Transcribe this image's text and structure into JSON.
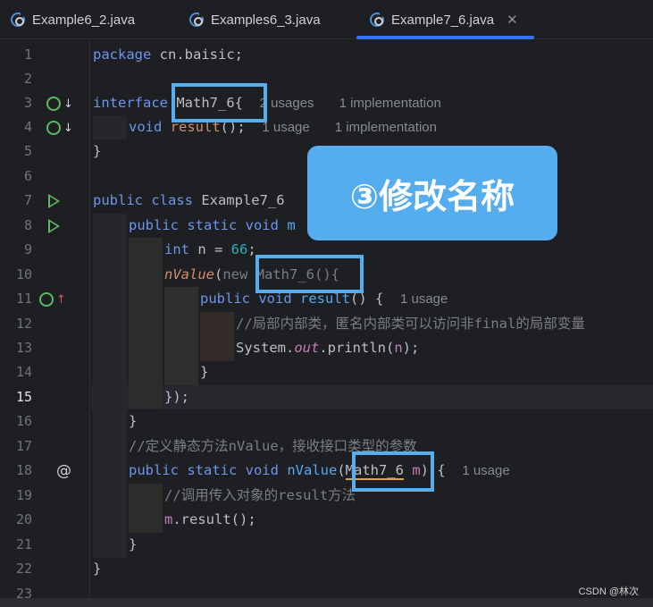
{
  "tabs": [
    {
      "label": "Example6_2.java",
      "active": false
    },
    {
      "label": "Examples6_3.java",
      "active": false
    },
    {
      "label": "Example7_6.java",
      "active": true
    }
  ],
  "line_numbers": [
    "1",
    "2",
    "3",
    "4",
    "5",
    "6",
    "7",
    "8",
    "9",
    "10",
    "11",
    "12",
    "13",
    "14",
    "15",
    "16",
    "17",
    "18",
    "19",
    "20",
    "21",
    "22",
    "23"
  ],
  "code": {
    "l1_kw": "package",
    "l1_rest": " cn.baisic;",
    "l3_kw": "interface",
    "l3_name": "Math7_6{",
    "l3_hint1": "2 usages",
    "l3_hint2": "1 implementation",
    "l4_kw": "void",
    "l4_fn": "result",
    "l4_rest": "();",
    "l4_hint1": "1 usage",
    "l4_hint2": "1 implementation",
    "l5": "}",
    "l7_kw": "public class",
    "l7_name": " Example7_6",
    "l8_kw": "public static void",
    "l8_fn": " m",
    "l9_kw": "int",
    "l9_mid": " n = ",
    "l9_num": "66",
    "l9_end": ";",
    "l10_fn": "nValue",
    "l10_paren": "(",
    "l10_new": "new ",
    "l10_type": "Math7_6(){",
    "l11_kw": "public void",
    "l11_fn": " result",
    "l11_rest": "() {",
    "l11_hint": "1 usage",
    "l12": "//局部内部类，匿名内部类可以访问非final的局部变量",
    "l13_a": "System.",
    "l13_b": "out",
    "l13_c": ".println(",
    "l13_d": "n",
    "l13_e": ");",
    "l14": "}",
    "l15": "});",
    "l16": "}",
    "l17": "//定义静态方法nValue，接收接口类型的参数",
    "l18_kw": "public static void",
    "l18_fn": " nValue",
    "l18_paren": "(",
    "l18_type": "Math7_6",
    "l18_param": " m",
    "l18_rest": ") {",
    "l18_hint": "1 usage",
    "l19": "//调用传入对象的result方法",
    "l20_a": "m",
    "l20_b": ".result();",
    "l21": "}",
    "l22": "}"
  },
  "callout": "③修改名称",
  "watermark": "CSDN @林次",
  "colors": {
    "accent": "#3574f0",
    "highlight_box": "#56aef0",
    "callout_bg": "#55acef"
  }
}
